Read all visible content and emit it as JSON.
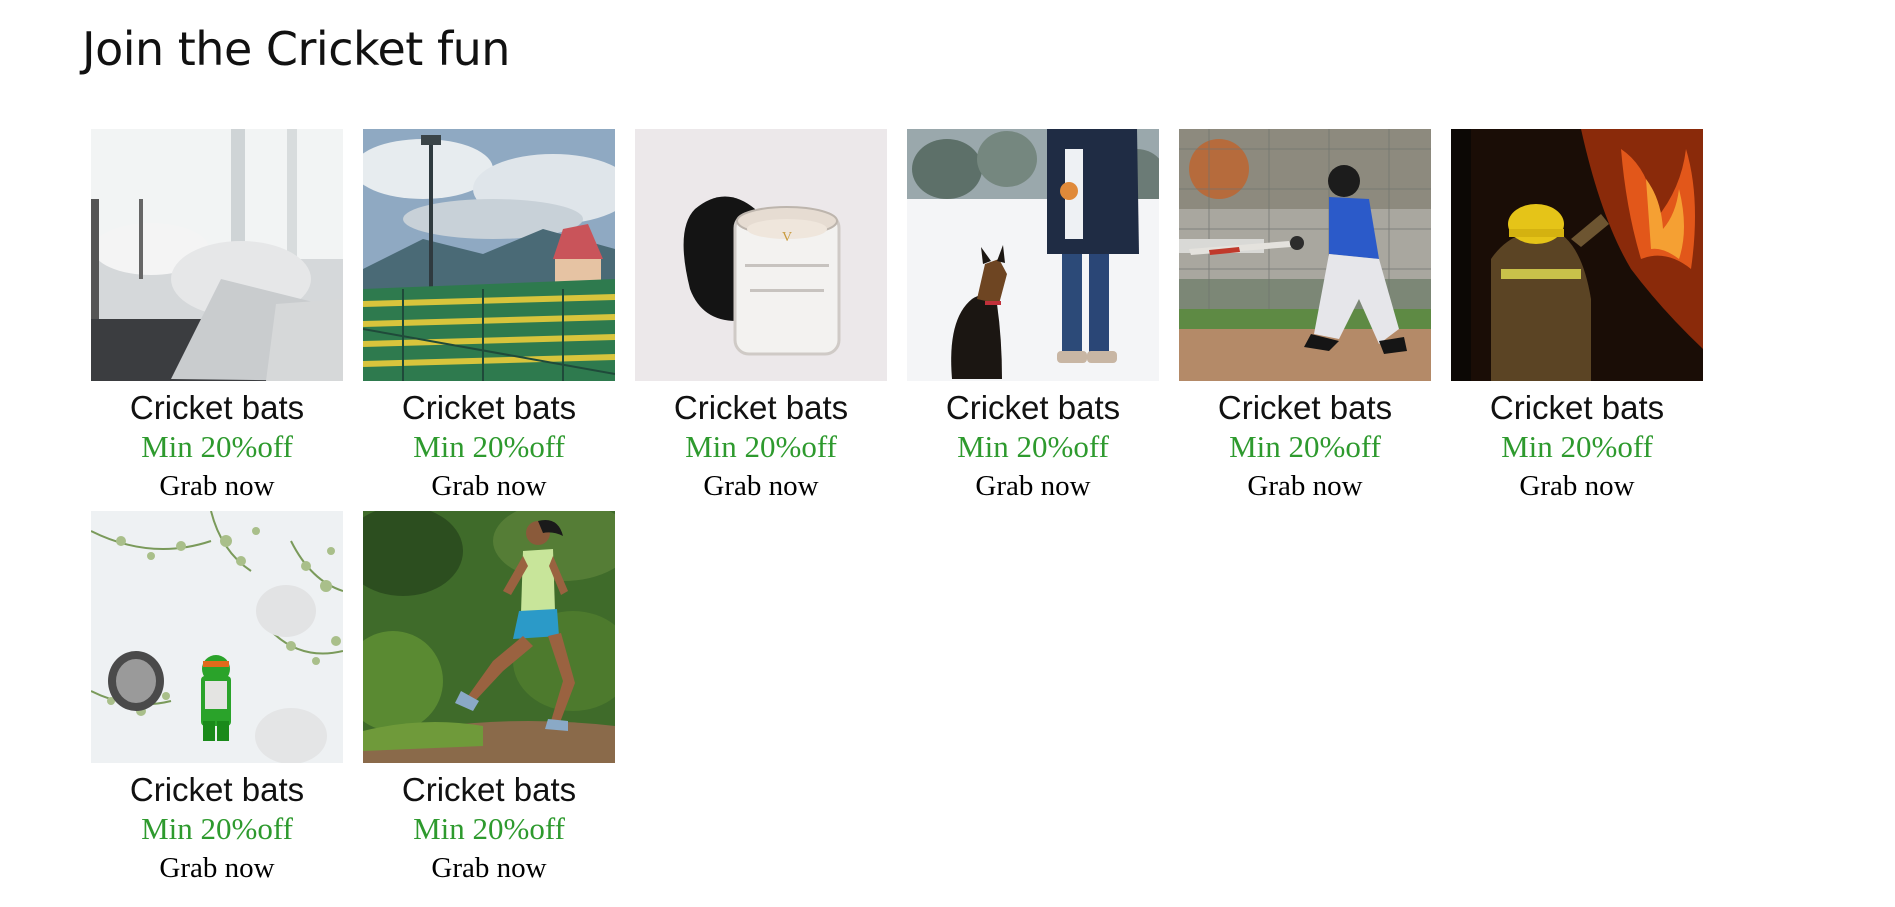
{
  "section": {
    "title": "Join the Cricket fun"
  },
  "theme": {
    "offer_color": "#2e9a2e"
  },
  "products": [
    {
      "image": "bedroom-pillows-image",
      "title": "Cricket bats",
      "offer": "Min 20%off",
      "cta": "Grab now"
    },
    {
      "image": "stadium-image",
      "title": "Cricket bats",
      "offer": "Min 20%off",
      "cta": "Grab now"
    },
    {
      "image": "candle-jar-image",
      "title": "Cricket bats",
      "offer": "Min 20%off",
      "cta": "Grab now"
    },
    {
      "image": "dog-in-snow-image",
      "title": "Cricket bats",
      "offer": "Min 20%off",
      "cta": "Grab now"
    },
    {
      "image": "baseball-batter-image",
      "title": "Cricket bats",
      "offer": "Min 20%off",
      "cta": "Grab now"
    },
    {
      "image": "firefighter-image",
      "title": "Cricket bats",
      "offer": "Min 20%off",
      "cta": "Grab now"
    },
    {
      "image": "toy-figure-flowers-image",
      "title": "Cricket bats",
      "offer": "Min 20%off",
      "cta": "Grab now"
    },
    {
      "image": "trail-runner-image",
      "title": "Cricket bats",
      "offer": "Min 20%off",
      "cta": "Grab now"
    }
  ]
}
